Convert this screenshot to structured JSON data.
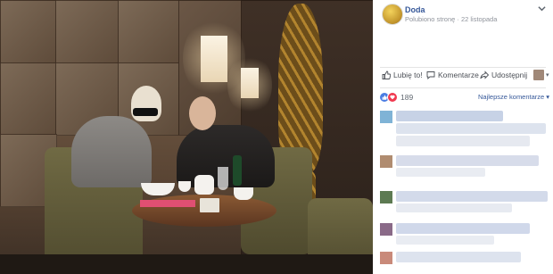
{
  "post": {
    "page_name": "Doda",
    "subtitle": "Polubiono stronę · 22 listopada",
    "menu_icon": "chevron-down-icon"
  },
  "actions": {
    "like_label": "Lubię to!",
    "comment_label": "Komentarze",
    "share_label": "Udostępnij"
  },
  "reactions": {
    "count": "189",
    "sort_label": "Najlepsze komentarze"
  },
  "colors": {
    "link": "#365899",
    "muted": "#90949c",
    "like_blue": "#4a7de2",
    "love_red": "#f0384f"
  }
}
